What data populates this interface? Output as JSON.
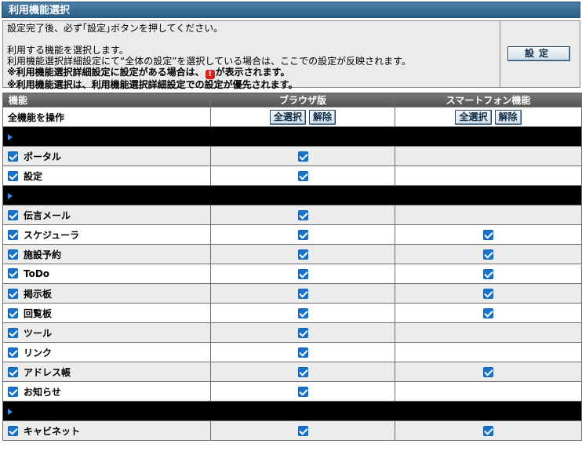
{
  "header": {
    "title": "利用機能選択"
  },
  "info": {
    "line1": "設定完了後、必ず｢設定｣ボタンを押してください。",
    "line2": "利用する機能を選択します。",
    "line3": "利用機能選択詳細設定にて“全体の設定”を選択している場合は、ここでの設定が反映されます。",
    "line4a": "※利用機能選択詳細設定に設定がある場合は、",
    "line4b": "が表示されます。",
    "line5": "※利用機能選択は、利用機能選択詳細設定での設定が優先されます。",
    "warn_glyph": "!"
  },
  "buttons": {
    "settei": "設定",
    "select_all": "全選択",
    "clear": "解除"
  },
  "table": {
    "headers": [
      "機能",
      "ブラウザ版",
      "スマートフォン機能"
    ],
    "all_ops_label": "全機能を操作",
    "rows": [
      {
        "type": "sep"
      },
      {
        "type": "item",
        "label": "ポータル",
        "browser": true,
        "smart": false
      },
      {
        "type": "item",
        "label": "設定",
        "browser": true,
        "smart": false
      },
      {
        "type": "sep"
      },
      {
        "type": "item",
        "label": "伝言メール",
        "browser": true,
        "smart": false
      },
      {
        "type": "item",
        "label": "スケジューラ",
        "browser": true,
        "smart": true
      },
      {
        "type": "item",
        "label": "施設予約",
        "browser": true,
        "smart": true
      },
      {
        "type": "item",
        "label": "ToDo",
        "browser": true,
        "smart": true
      },
      {
        "type": "item",
        "label": "掲示板",
        "browser": true,
        "smart": true
      },
      {
        "type": "item",
        "label": "回覧板",
        "browser": true,
        "smart": true
      },
      {
        "type": "item",
        "label": "ツール",
        "browser": true,
        "smart": false
      },
      {
        "type": "item",
        "label": "リンク",
        "browser": true,
        "smart": false
      },
      {
        "type": "item",
        "label": "アドレス帳",
        "browser": true,
        "smart": true
      },
      {
        "type": "item",
        "label": "お知らせ",
        "browser": true,
        "smart": false
      },
      {
        "type": "sep"
      },
      {
        "type": "item",
        "label": "キャビネット",
        "browser": true,
        "smart": true
      }
    ]
  }
}
